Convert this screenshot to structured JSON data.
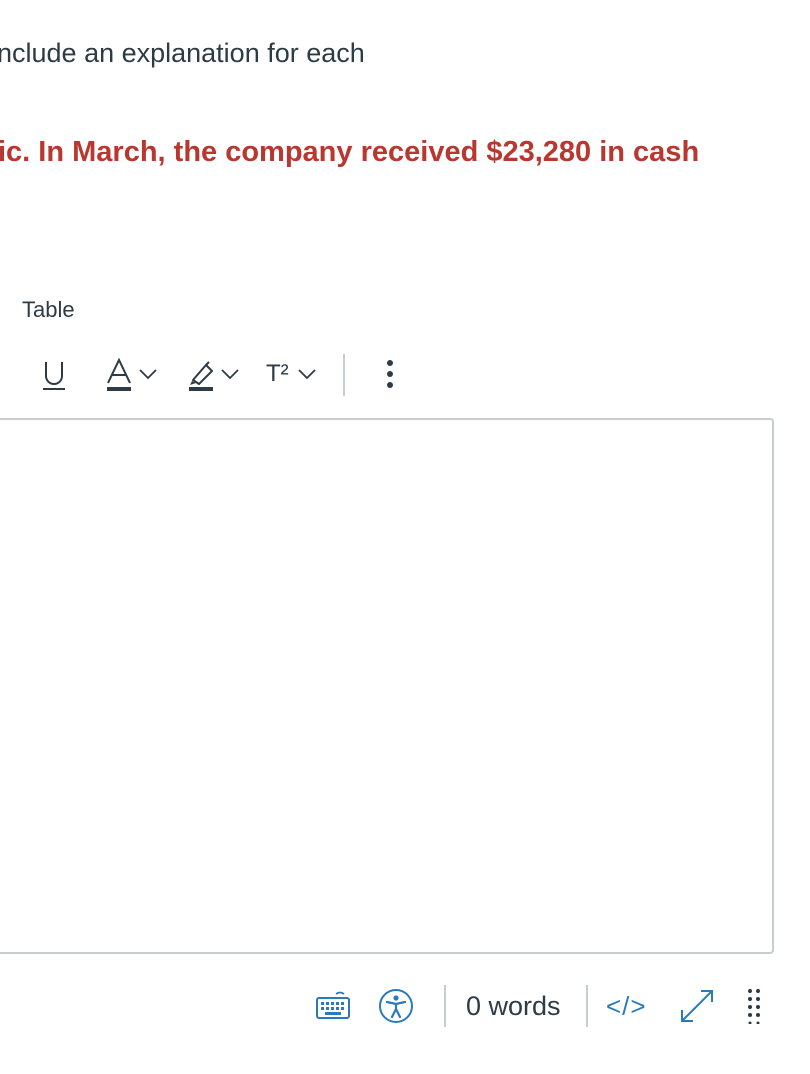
{
  "question": {
    "instruction_fragment": "nclude an explanation for each",
    "highlight_fragment": "ic. In March, the company received $23,280 in cash"
  },
  "editor_menu": {
    "table_label": "Table"
  },
  "toolbar": {
    "underline_icon": "underline-icon",
    "text_color_icon": "text-color-icon",
    "highlight_icon": "highlight-color-icon",
    "superscript_label": "T²",
    "more_icon": "more-vertical-icon",
    "accent_color": "#2d3b45"
  },
  "editor": {
    "content": ""
  },
  "statusbar": {
    "keyboard_icon": "keyboard-icon",
    "accessibility_icon": "accessibility-icon",
    "word_count": "0 words",
    "html_toggle": "</>",
    "fullscreen_icon": "expand-icon",
    "drag_handle_icon": "drag-handle-icon",
    "link_color": "#2b7abc"
  }
}
